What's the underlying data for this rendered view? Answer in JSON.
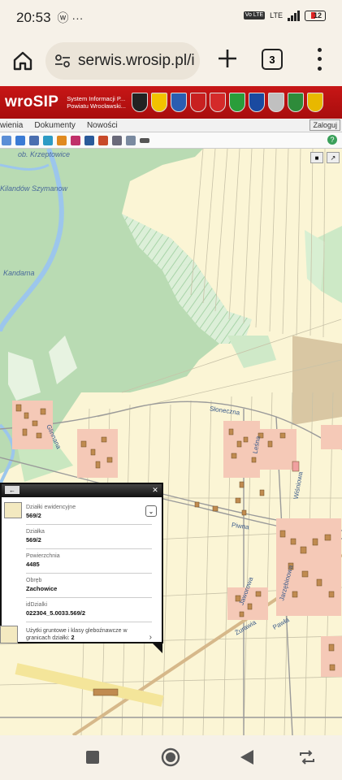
{
  "status": {
    "time": "20:53",
    "left_icons": "ⓦ ···",
    "network": "LTE",
    "volte": "Vo LTE",
    "battery": "12"
  },
  "browser": {
    "url": "serwis.wrosip.pl/i",
    "tab_count": "3"
  },
  "site": {
    "logo": "wroSIP",
    "subtitle": "System Informacji P... Powiatu Wrocławski...",
    "crest_colors": [
      "#222",
      "#f2c200",
      "#2a5db0",
      "#c82020",
      "#d42a2a",
      "#2a9d3a",
      "#1a4aa0",
      "#c0c0c0",
      "#2e8b3a",
      "#e8b800"
    ]
  },
  "menu": {
    "items": [
      "wienia",
      "Dokumenty",
      "Nowości"
    ],
    "login": "Zaloguj"
  },
  "map": {
    "labels": {
      "village1": "ob. Krzeptowice",
      "village2": "Kilandów Szymanow",
      "place3": "Kandama",
      "street_sloneczna": "Słoneczna",
      "street_glinnana": "Glinnana",
      "street_wisniowa": "Wiśniowa",
      "street_piwna": "Piwna",
      "street_jaworowa": "Jaworowa",
      "street_lesna": "Leśna",
      "street_jarzebinowa": "Jarzębinowa",
      "street_pawla": "Pawła",
      "street_zurawia": "Żurawia"
    }
  },
  "popup": {
    "title_label": "Działki ewidencyjne",
    "title_value": "569/2",
    "fields": [
      {
        "label": "Działka",
        "value": "569/2"
      },
      {
        "label": "Powierzchnia",
        "value": "4485"
      },
      {
        "label": "Obręb",
        "value": "Zachowice"
      },
      {
        "label": "idDzialki",
        "value": "022304_5.0033.569/2"
      }
    ],
    "footer_label": "Użytki gruntowe i klasy gleboźnawcze w granicach działki:",
    "footer_value": "2"
  }
}
